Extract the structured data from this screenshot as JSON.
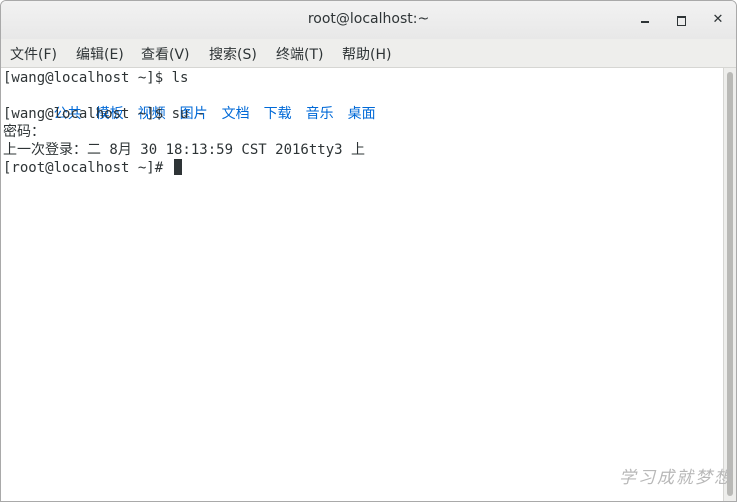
{
  "window": {
    "title": "root@localhost:~",
    "controls": {
      "minimize": "–",
      "maximize": "□",
      "close": "✕"
    }
  },
  "menubar": {
    "items": [
      "文件(F)",
      "编辑(E)",
      "查看(V)",
      "搜索(S)",
      "终端(T)",
      "帮助(H)"
    ]
  },
  "terminal": {
    "line1": "[wang@localhost ~]$ ls",
    "dirs": [
      "公共",
      "模板",
      "视频",
      "图片",
      "文档",
      "下载",
      "音乐",
      "桌面"
    ],
    "line3": "[wang@localhost ~]$ su -",
    "line4": "密码：",
    "line5": "上一次登录：二 8月 30 18:13:59 CST 2016tty3 上",
    "line6": "[root@localhost ~]# "
  },
  "colors": {
    "directory": "#0069d7",
    "text": "#2e3436",
    "background": "#ffffff"
  },
  "watermark": "学习成就梦想"
}
